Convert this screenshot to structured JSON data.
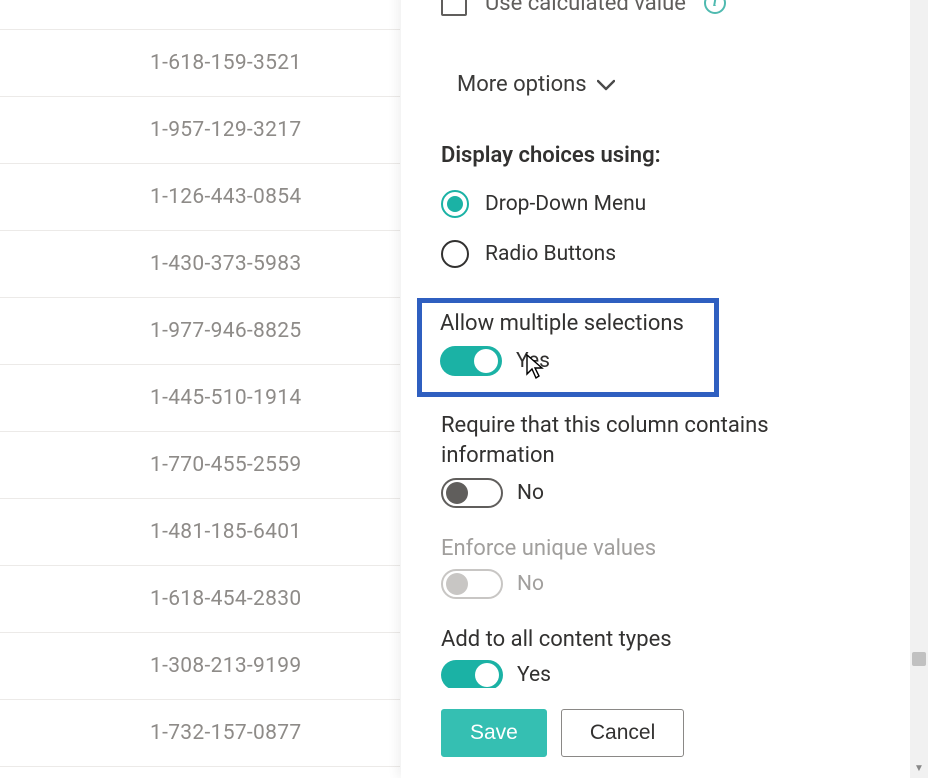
{
  "bg_list": {
    "rows": [
      "",
      "1-618-159-3521",
      "1-957-129-3217",
      "1-126-443-0854",
      "1-430-373-5983",
      "1-977-946-8825",
      "1-445-510-1914",
      "1-770-455-2559",
      "1-481-185-6401",
      "1-618-454-2830",
      "1-308-213-9199",
      "1-732-157-0877"
    ]
  },
  "panel": {
    "calculated": {
      "label": "Use calculated value"
    },
    "more_options_label": "More options",
    "display_choices_heading": "Display choices using:",
    "display_choices": {
      "dropdown": "Drop-Down Menu",
      "radio": "Radio Buttons"
    },
    "allow_multiple": {
      "heading": "Allow multiple selections",
      "value_label": "Yes"
    },
    "require_info": {
      "heading": "Require that this column contains information",
      "value_label": "No"
    },
    "unique": {
      "heading": "Enforce unique values",
      "value_label": "No"
    },
    "content_types": {
      "heading": "Add to all content types",
      "value_label": "Yes"
    },
    "footer": {
      "save": "Save",
      "cancel": "Cancel"
    }
  }
}
